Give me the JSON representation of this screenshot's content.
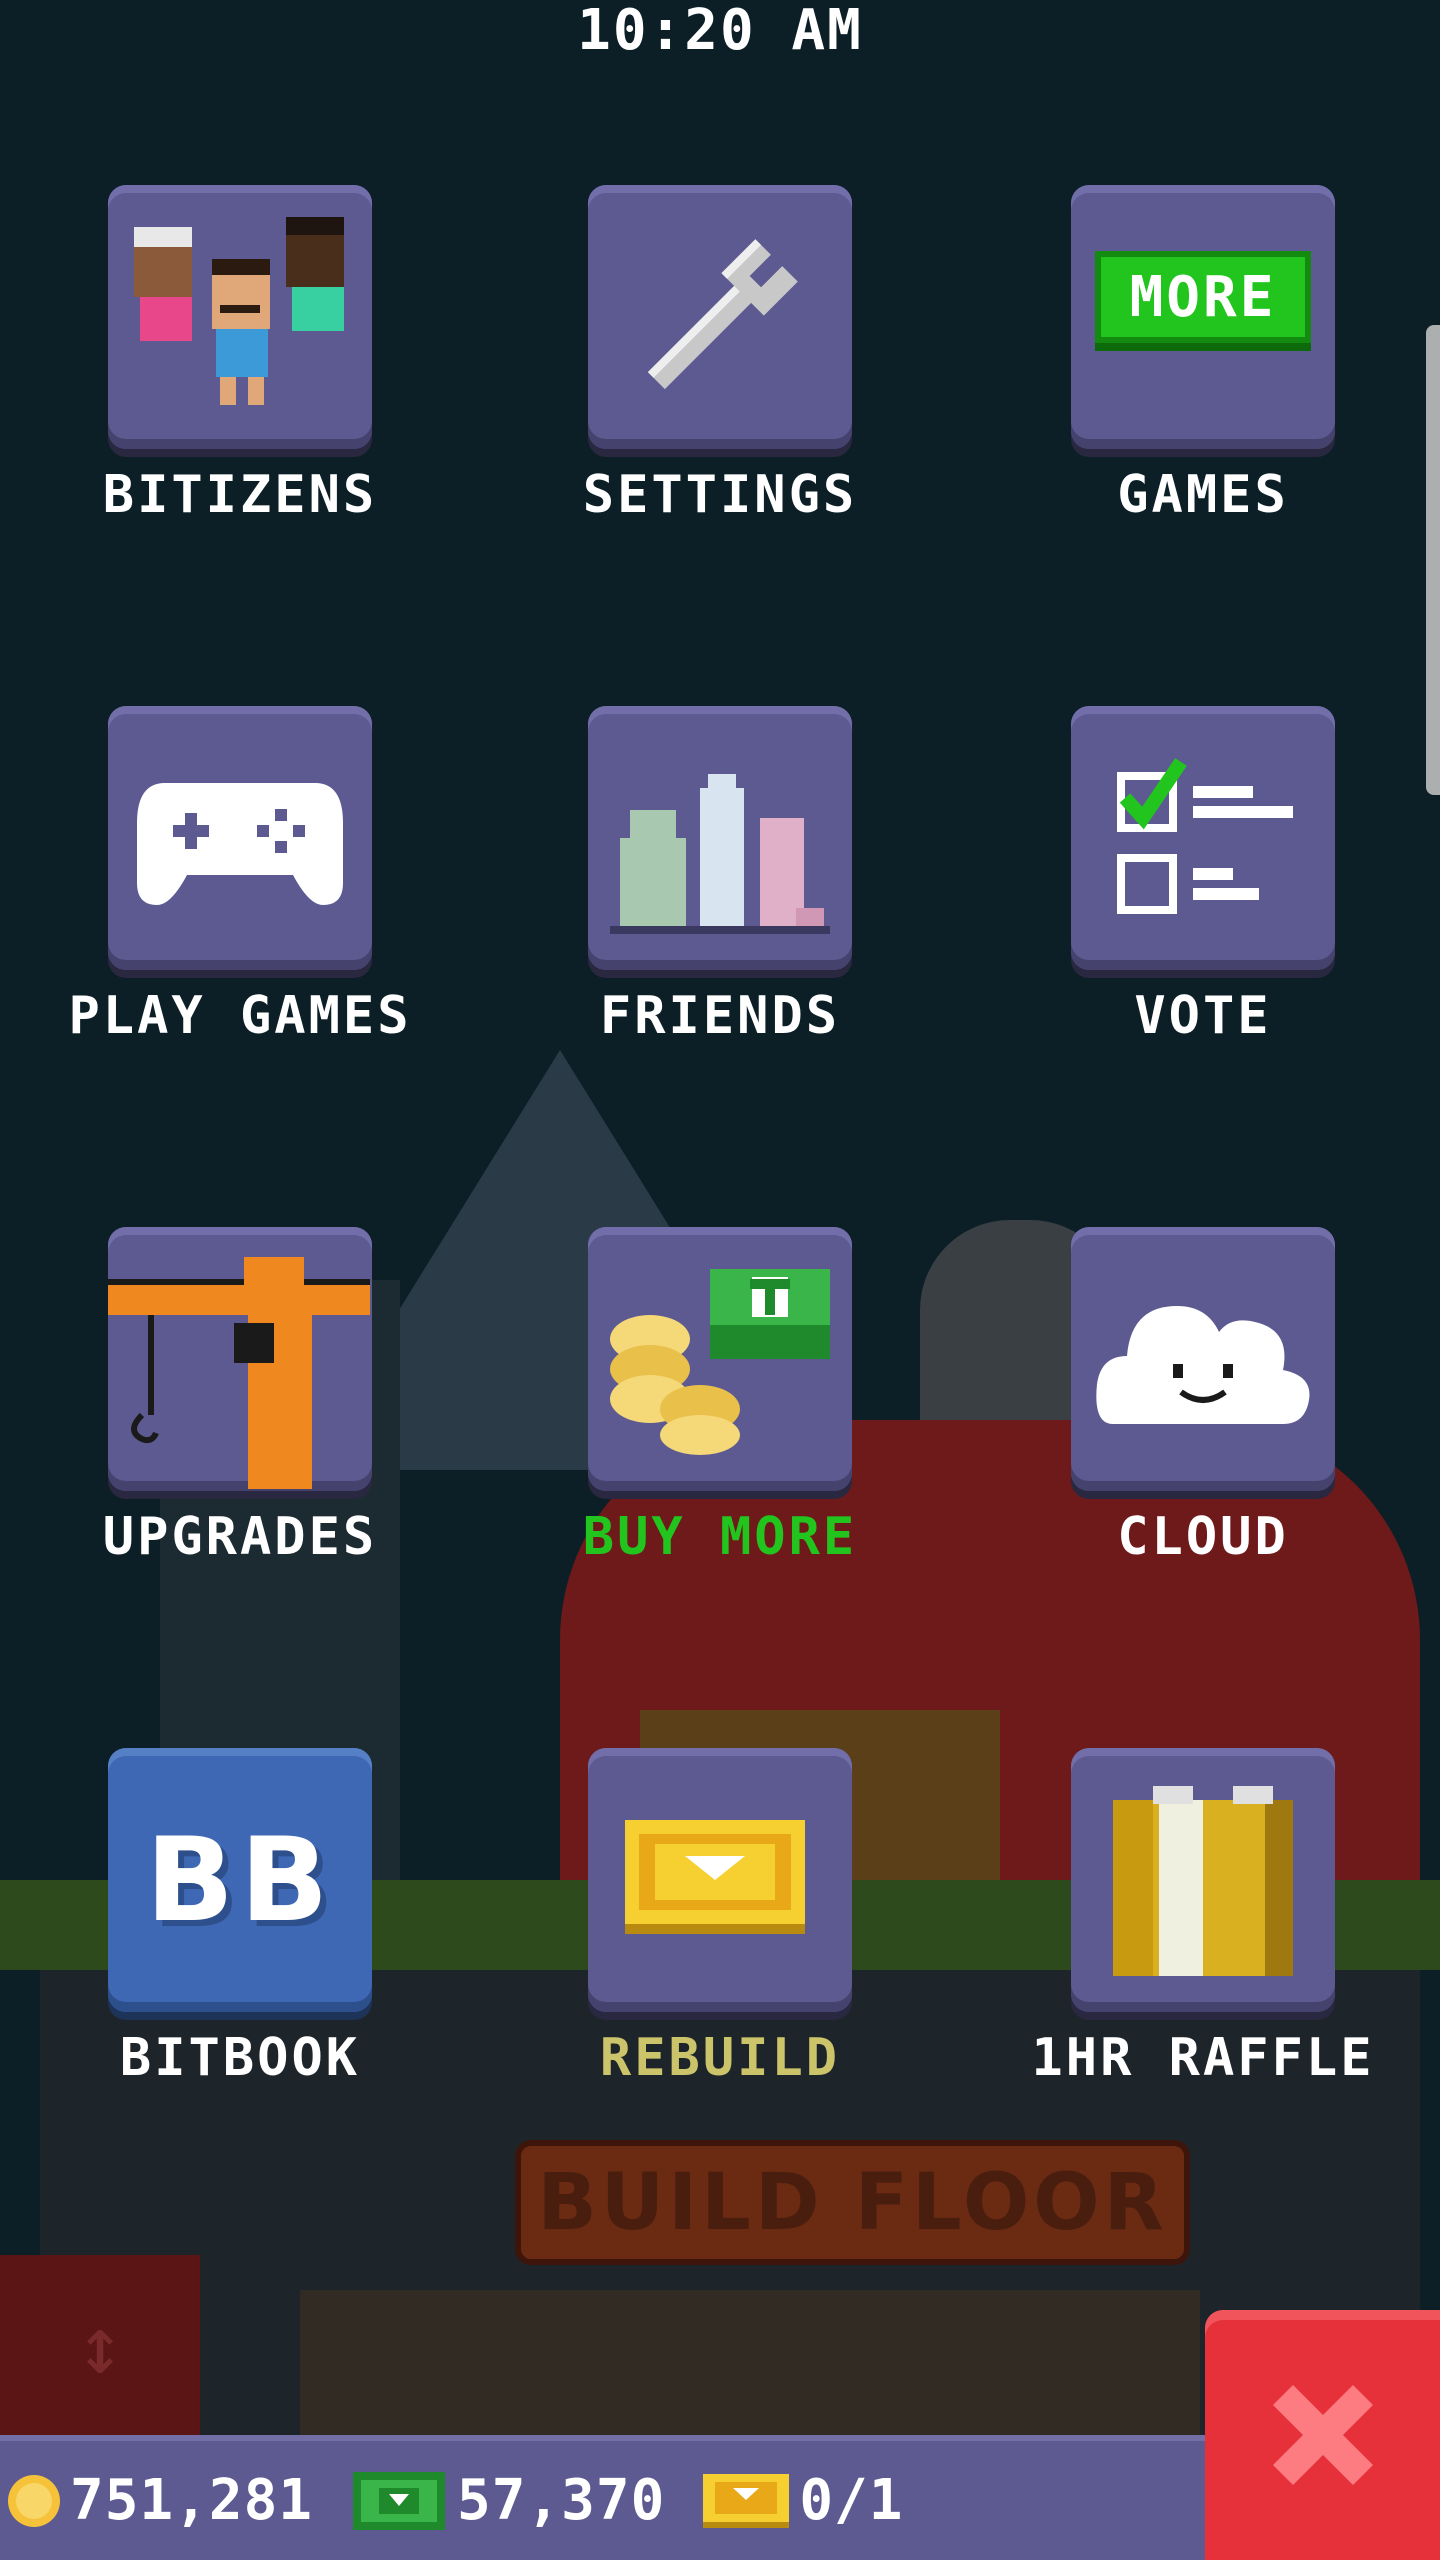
{
  "status_bar": {
    "time": "10:20 AM"
  },
  "menu": {
    "items": [
      {
        "id": "bitizens",
        "label": "BITIZENS",
        "icon": "people-icon"
      },
      {
        "id": "settings",
        "label": "SETTINGS",
        "icon": "wrench-icon"
      },
      {
        "id": "more_games",
        "label": "GAMES",
        "icon": "more-badge-icon",
        "badge": "MORE"
      },
      {
        "id": "play_games",
        "label": "PLAY GAMES",
        "icon": "gamepad-icon"
      },
      {
        "id": "friends",
        "label": "FRIENDS",
        "icon": "city-buildings-icon"
      },
      {
        "id": "vote",
        "label": "VOTE",
        "icon": "checklist-icon"
      },
      {
        "id": "upgrades",
        "label": "UPGRADES",
        "icon": "crane-icon"
      },
      {
        "id": "buy_more",
        "label": "BUY MORE",
        "icon": "coins-and-bux-icon",
        "color": "#22c51e"
      },
      {
        "id": "cloud",
        "label": "CLOUD",
        "icon": "cloud-icon"
      },
      {
        "id": "bitbook",
        "label": "BITBOOK",
        "icon": "bb-logo-icon",
        "logo_text": "BB"
      },
      {
        "id": "rebuild",
        "label": "REBUILD",
        "icon": "golden-ticket-icon",
        "color": "#cbc46a"
      },
      {
        "id": "raffle",
        "label": "1HR RAFFLE",
        "icon": "raffle-ticket-icon"
      }
    ]
  },
  "background": {
    "sign_text": "BUILD FLOOR"
  },
  "currency": {
    "coins": "751,281",
    "bux": "57,370",
    "tickets": "0/1"
  },
  "colors": {
    "tile": "#5d5a92",
    "tile_blue": "#3f68b4",
    "close_button": "#e6313b",
    "accent_green": "#22c51e",
    "accent_yellow": "#cbc46a"
  }
}
